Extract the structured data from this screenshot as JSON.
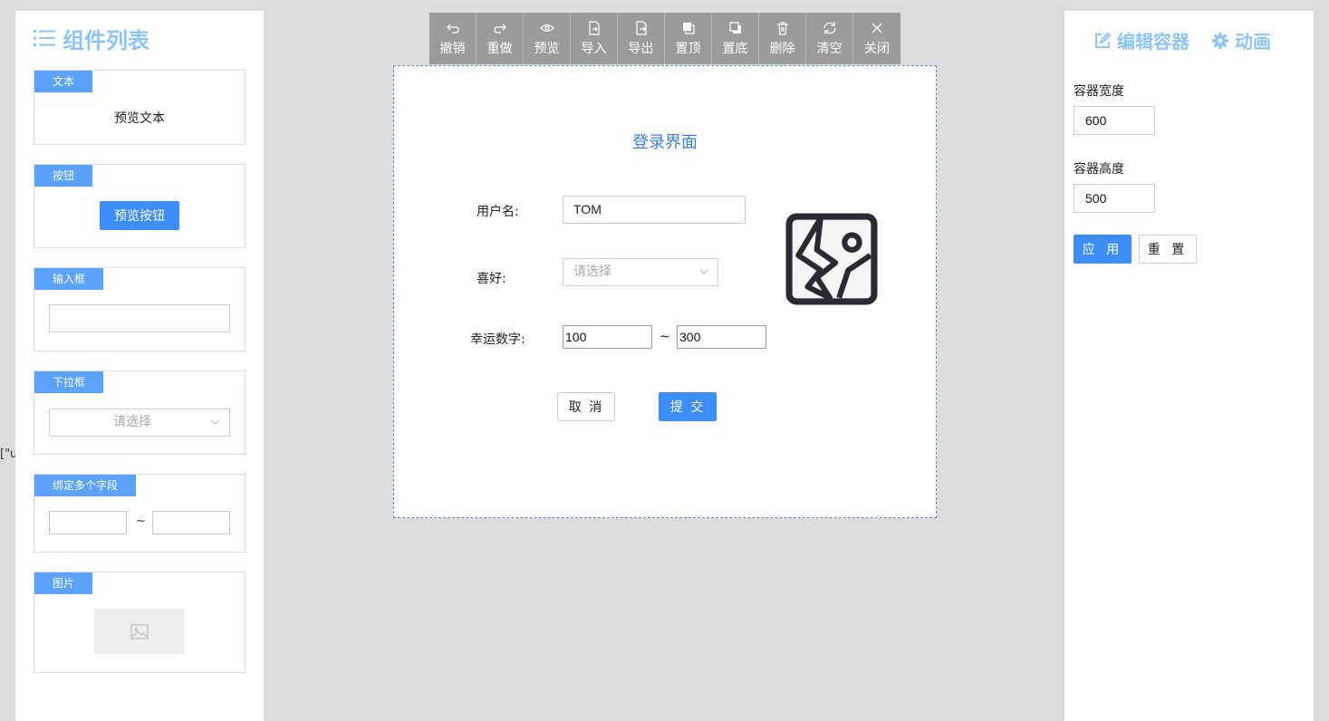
{
  "stray_text": "[\"us",
  "left": {
    "title": "组件列表",
    "cards": {
      "text": {
        "tag": "文本",
        "preview": "预览文本"
      },
      "button": {
        "tag": "按钮",
        "preview": "预览按钮"
      },
      "input": {
        "tag": "输入框"
      },
      "select": {
        "tag": "下拉框",
        "placeholder": "请选择"
      },
      "range": {
        "tag": "绑定多个字段",
        "separator": "~"
      },
      "image": {
        "tag": "图片"
      }
    }
  },
  "toolbar": {
    "items": [
      {
        "label": "撤销",
        "icon": "undo-icon"
      },
      {
        "label": "重做",
        "icon": "redo-icon"
      },
      {
        "label": "预览",
        "icon": "eye-icon"
      },
      {
        "label": "导入",
        "icon": "import-icon"
      },
      {
        "label": "导出",
        "icon": "export-icon"
      },
      {
        "label": "置顶",
        "icon": "bring-top-icon"
      },
      {
        "label": "置底",
        "icon": "send-bottom-icon"
      },
      {
        "label": "删除",
        "icon": "trash-icon"
      },
      {
        "label": "清空",
        "icon": "refresh-icon"
      },
      {
        "label": "关闭",
        "icon": "close-icon"
      }
    ]
  },
  "canvas": {
    "title": "登录界面",
    "username_label": "用户名:",
    "username_value": "TOM",
    "hobby_label": "喜好:",
    "hobby_placeholder": "请选择",
    "lucky_label": "幸运数字:",
    "lucky_min": "100",
    "lucky_sep": "~",
    "lucky_max": "300",
    "cancel_label": "取 消",
    "submit_label": "提 交"
  },
  "right": {
    "tab_edit": "编辑容器",
    "tab_anim": "动画",
    "width_label": "容器宽度",
    "width_value": "600",
    "height_label": "容器高度",
    "height_value": "500",
    "apply_label": "应 用",
    "reset_label": "重 置"
  },
  "colors": {
    "accent": "#3d8ef8",
    "tag": "#5aa2fa",
    "title_light": "#8ec5f5",
    "canvas_border": "#4a8fde",
    "toolbar": "#9b9b9b"
  }
}
